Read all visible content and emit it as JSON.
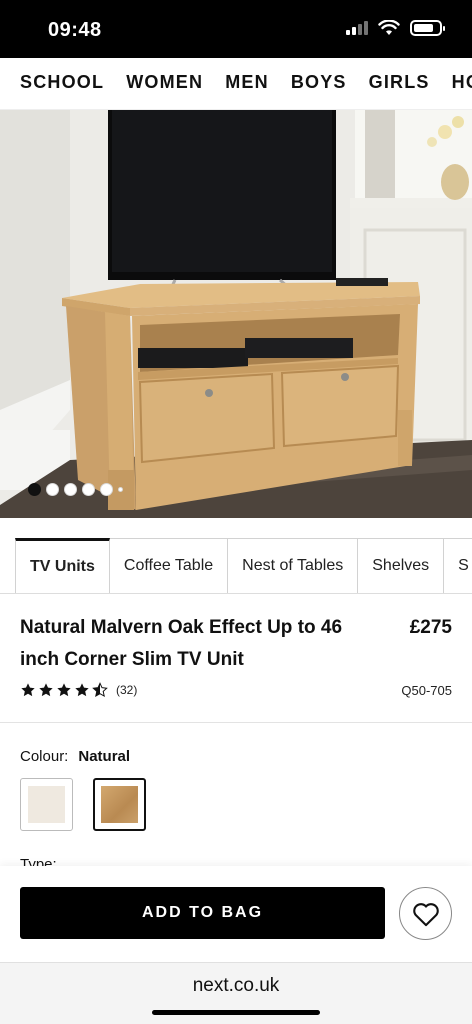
{
  "status_bar": {
    "time": "09:48",
    "icons": [
      "cellular-signal-icon",
      "wifi-icon",
      "battery-icon"
    ],
    "battery_level": 0.8
  },
  "category_nav": {
    "items": [
      "SCHOOL",
      "WOMEN",
      "MEN",
      "BOYS",
      "GIRLS",
      "HOME"
    ]
  },
  "gallery": {
    "total_images": 6,
    "current_index": 1
  },
  "tabs": {
    "items": [
      {
        "label": "TV Units",
        "active": true
      },
      {
        "label": "Coffee Table",
        "active": false
      },
      {
        "label": "Nest of Tables",
        "active": false
      },
      {
        "label": "Shelves",
        "active": false
      },
      {
        "label": "S",
        "active": false
      }
    ]
  },
  "product": {
    "title": "Natural Malvern Oak Effect Up to 46 inch Corner Slim TV Unit",
    "price": "£275",
    "rating": 4.5,
    "review_count": "(32)",
    "code": "Q50-705"
  },
  "colour": {
    "label": "Colour:",
    "selected": "Natural",
    "options": [
      {
        "name": "cream",
        "color": "#efe9e0"
      },
      {
        "name": "natural",
        "color": "#c79a62"
      }
    ]
  },
  "type": {
    "label": "Type:"
  },
  "actions": {
    "add_to_bag": "ADD TO BAG"
  },
  "browser": {
    "url": "next.co.uk"
  },
  "colors": {
    "accent": "#000000",
    "oak": "#d9b27a"
  }
}
